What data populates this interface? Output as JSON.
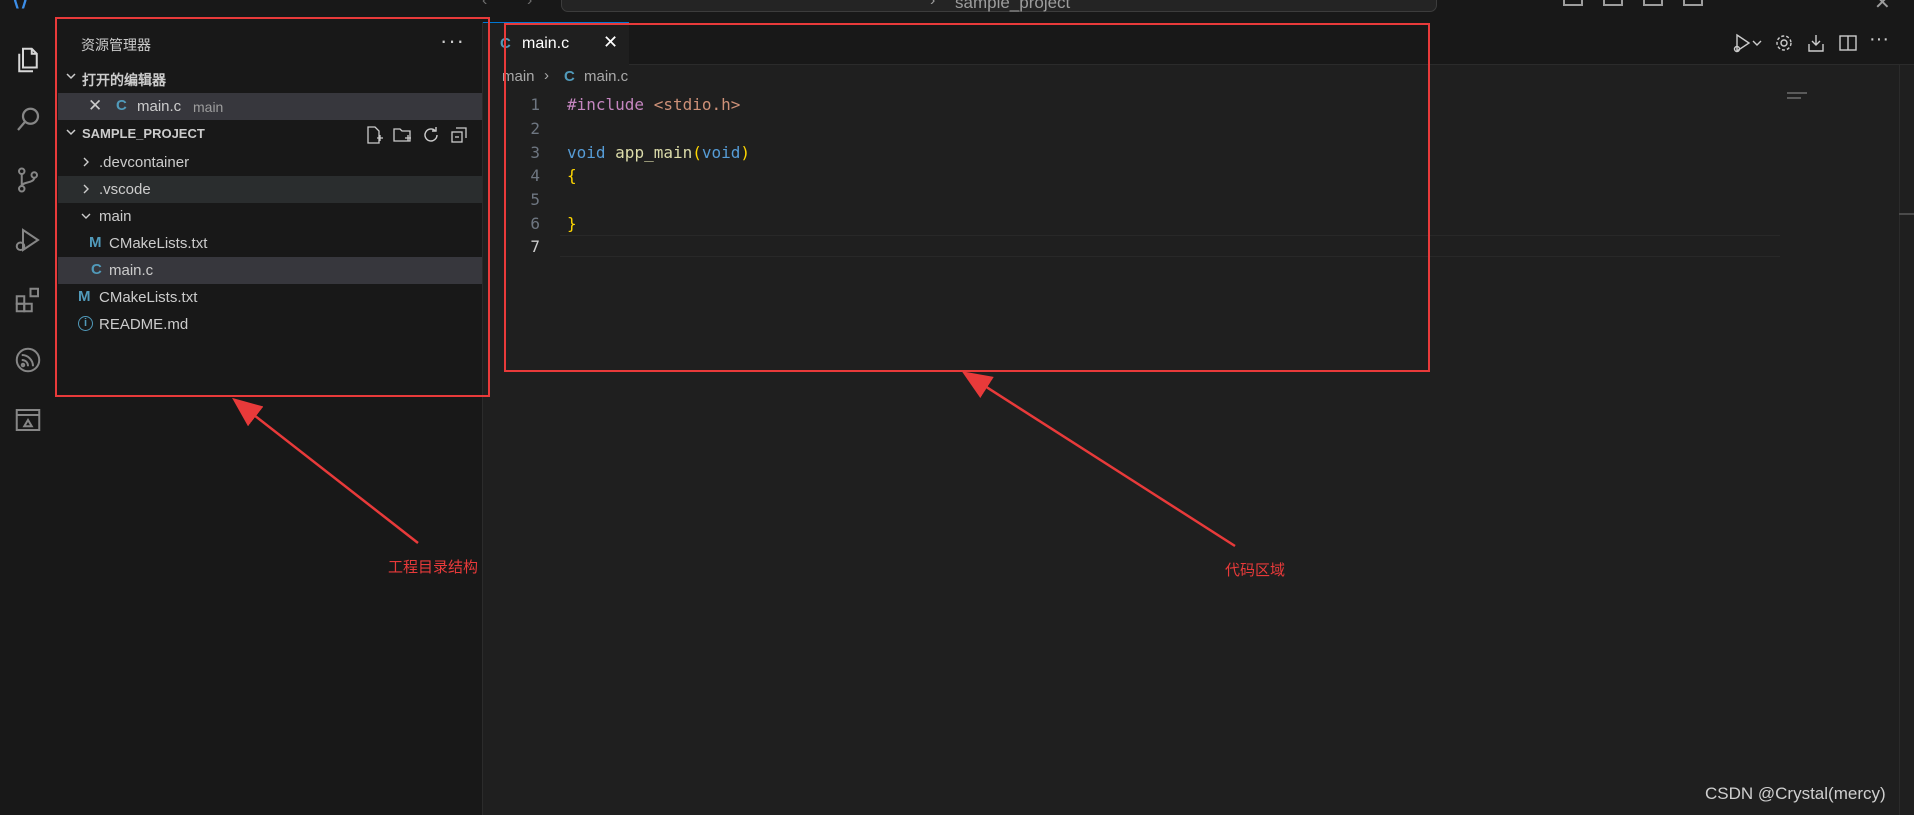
{
  "titlebar": {
    "window_title": "sample_project",
    "nav_back_icon": "arrow-left-icon",
    "nav_forward_icon": "arrow-right-icon"
  },
  "activity_bar": [
    {
      "name": "explorer",
      "icon": "files-icon"
    },
    {
      "name": "search",
      "icon": "search-icon"
    },
    {
      "name": "source-control",
      "icon": "source-control-icon"
    },
    {
      "name": "run-and-debug",
      "icon": "debug-icon"
    },
    {
      "name": "extensions",
      "icon": "extensions-icon"
    },
    {
      "name": "esp-idf",
      "icon": "espressif-icon"
    },
    {
      "name": "remote-explorer",
      "icon": "remote-explorer-icon"
    }
  ],
  "sidebar": {
    "title": "资源管理器",
    "more_label": "···",
    "open_editors": {
      "header": "打开的编辑器",
      "items": [
        {
          "close_glyph": "✕",
          "icon_text": "C",
          "label": "main.c",
          "description": "main"
        }
      ]
    },
    "project": {
      "header": "SAMPLE_PROJECT",
      "tree": [
        {
          "type": "folder",
          "label": ".devcontainer",
          "expanded": false
        },
        {
          "type": "folder",
          "label": ".vscode",
          "expanded": false
        },
        {
          "type": "folder",
          "label": "main",
          "expanded": true
        },
        {
          "type": "file",
          "icon_text": "M",
          "label": "CMakeLists.txt"
        },
        {
          "type": "file",
          "icon_text": "C",
          "label": "main.c"
        },
        {
          "type": "file",
          "icon_text": "M",
          "label": "CMakeLists.txt"
        },
        {
          "type": "file",
          "icon_text": "i",
          "label": "README.md"
        }
      ]
    }
  },
  "editor": {
    "tab": {
      "icon_text": "C",
      "label": "main.c",
      "close_glyph": "✕"
    },
    "breadcrumb": {
      "root": "main",
      "separator": "›",
      "icon_text": "C",
      "file": "main.c"
    },
    "line_numbers": [
      "1",
      "2",
      "3",
      "4",
      "5",
      "6",
      "7"
    ],
    "code": {
      "line1_directive": "#include",
      "line1_header": "<stdio.h>",
      "line3_type": "void",
      "line3_func": "app_main",
      "line3_paren_open": "(",
      "line3_param": "void",
      "line3_paren_close": ")",
      "line4": "{",
      "line6": "}"
    }
  },
  "annotations": {
    "explorer_label": "工程目录结构",
    "code_label": "代码区域"
  },
  "watermark": "CSDN @Crystal(mercy)",
  "colors": {
    "annotation_red": "#e83a3a",
    "keyword_blue": "#569cd6",
    "directive_purple": "#c586c0",
    "string_orange": "#ce9178",
    "function_yellow": "#dcdcaa",
    "bracket_gold": "#ffd700",
    "file_icon_blue": "#519aba"
  }
}
